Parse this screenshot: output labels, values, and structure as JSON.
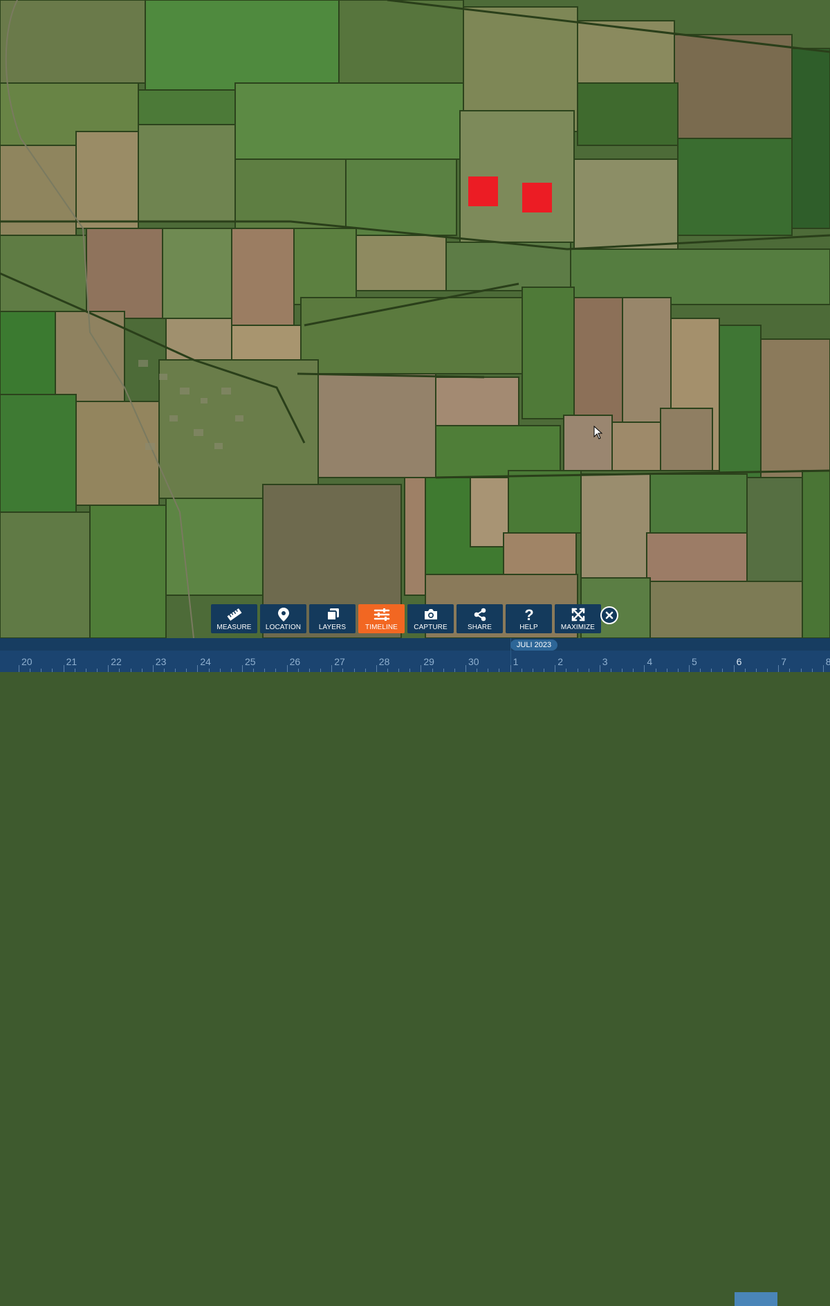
{
  "toolbar": {
    "buttons": [
      {
        "label": "MEASURE",
        "icon": "ruler-icon"
      },
      {
        "label": "LOCATION",
        "icon": "map-pin-icon"
      },
      {
        "label": "LAYERS",
        "icon": "layers-icon"
      },
      {
        "label": "TIMELINE",
        "icon": "sliders-icon",
        "active": true
      },
      {
        "label": "CAPTURE",
        "icon": "camera-icon"
      },
      {
        "label": "SHARE",
        "icon": "share-icon"
      },
      {
        "label": "HELP",
        "icon": "question-icon"
      },
      {
        "label": "MAXIMIZE",
        "icon": "expand-icon"
      }
    ],
    "close_icon": "close-icon"
  },
  "timeline": {
    "month": "JULI 2023",
    "days": [
      "20",
      "21",
      "22",
      "23",
      "24",
      "25",
      "26",
      "27",
      "28",
      "29",
      "30",
      "1",
      "2",
      "3",
      "4",
      "5",
      "6",
      "7",
      "8"
    ],
    "selected_day": "6",
    "colors": {
      "background": "#173d61",
      "active": "#f26722",
      "highlight": "#4a85b8"
    }
  },
  "map": {
    "type": "satellite imagery",
    "markers": 2,
    "marker_color": "#ec1c24"
  }
}
